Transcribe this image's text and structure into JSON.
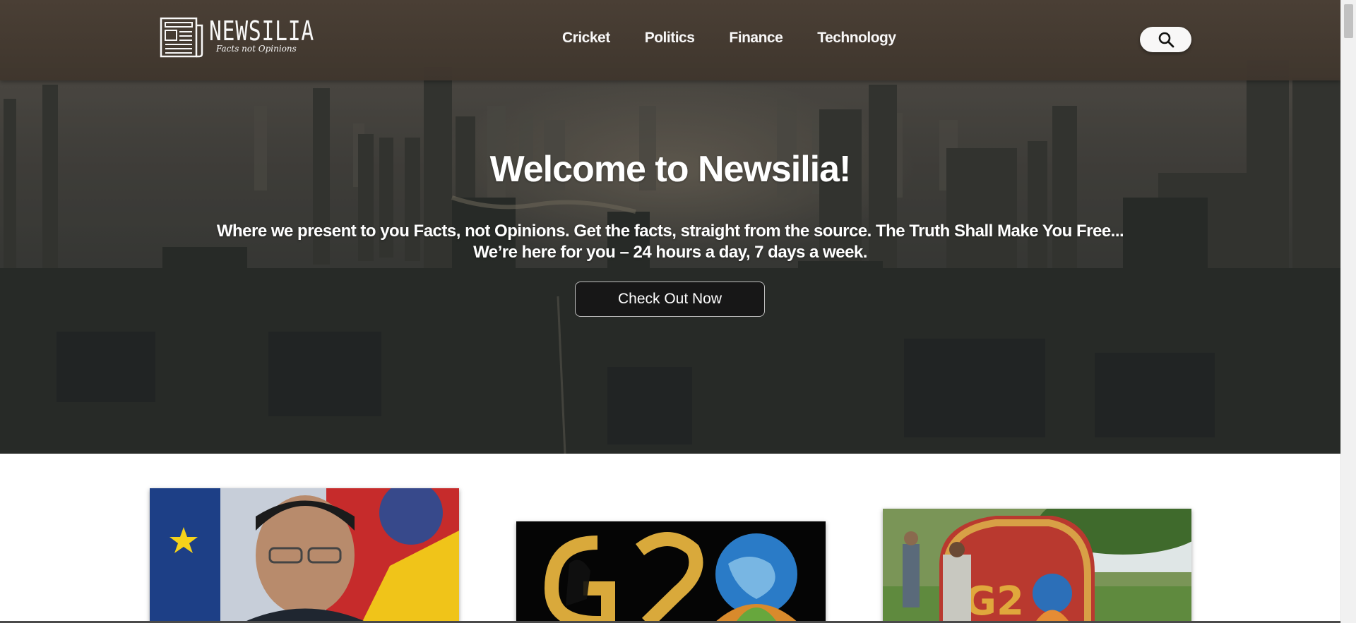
{
  "brand": {
    "name": "NEWSILIA",
    "tagline": "Facts not Opinions"
  },
  "nav": {
    "items": [
      {
        "label": "Cricket"
      },
      {
        "label": "Politics"
      },
      {
        "label": "Finance"
      },
      {
        "label": "Technology"
      }
    ],
    "search_icon": "search-icon"
  },
  "hero": {
    "title": "Welcome to Newsilia!",
    "subtitle_line1": "Where we present to you Facts, not Opinions. Get the facts, straight from the source. The Truth Shall Make You Free...",
    "subtitle_line2": "We’re here for you – 24 hours a day, 7 days a week.",
    "cta_label": "Check Out Now"
  },
  "cards": [
    {
      "image": "politician-portrait-with-flags"
    },
    {
      "image": "g20-logo-silhouette"
    },
    {
      "image": "g20-outdoor-sign"
    }
  ],
  "colors": {
    "nav_bg": "#3f362d",
    "cta_bg": "#171717",
    "accent_white": "#ffffff"
  }
}
